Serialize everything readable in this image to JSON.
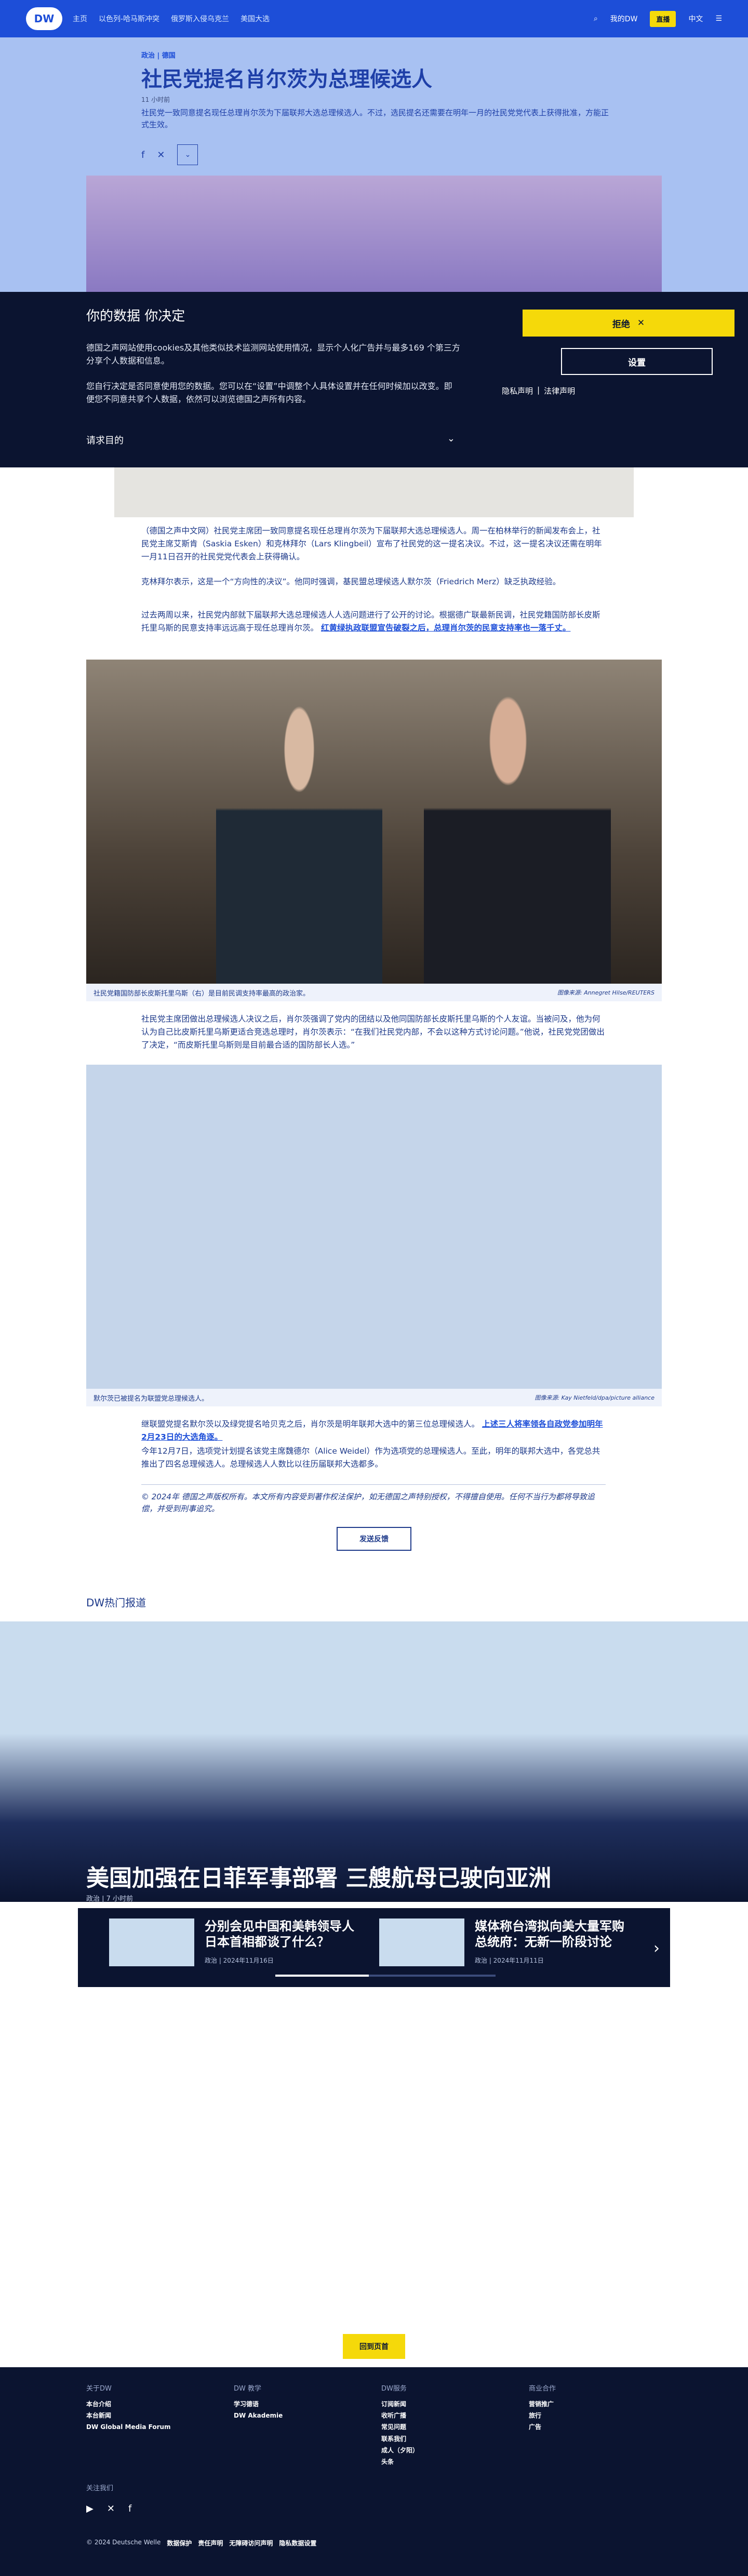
{
  "nav": {
    "logo": "DW",
    "links": [
      "主页",
      "以色列-哈马斯冲突",
      "俄罗斯入侵乌克兰",
      "美国大选"
    ],
    "account": "我的DW",
    "live": "直播",
    "lang": "中文"
  },
  "article": {
    "breadcrumb": "政治 | 德国",
    "title": "社民党提名肖尔茨为总理候选人",
    "date": "11 小时前",
    "lead": "社民党一致同意提名现任总理肖尔茨为下届联邦大选总理候选人。不过，选民提名还需要在明年一月的社民党党代表上获得批准，方能正式生效。",
    "p1": "（德国之声中文网）社民党主席团一致同意提名现任总理肖尔茨为下届联邦大选总理候选人。周一在柏林举行的新闻发布会上，社民党主席艾斯肯（Saskia Esken）和克林拜尔（Lars Klingbeil）宣布了社民党的这一提名决议。不过，这一提名决议还需在明年一月11日召开的社民党党代表会上获得确认。",
    "p2": "克林拜尔表示，这是一个“方向性的决议”。他同时强调，基民盟总理候选人默尔茨（Friedrich Merz）缺乏执政经验。",
    "p3": "过去两周以来，社民党内部就下届联邦大选总理候选人人选问题进行了公开的讨论。根据德广联最新民调，社民党籍国防部长皮斯托里乌斯的民意支持率远远高于现任总理肖尔茨。",
    "p3_link": "红黄绿执政联盟宣告破裂之后，总理肖尔茨的民意支持率也一落千丈。",
    "caption1": "社民党籍国防部长皮斯托里乌斯（右）是目前民调支持率最高的政治家。",
    "credit1": "图像来源: Annegret Hilse/REUTERS",
    "p4": "社民党主席团做出总理候选人决议之后，肖尔茨强调了党内的团结以及他同国防部长皮斯托里乌斯的个人友谊。当被问及，他为何认为自己比皮斯托里乌斯更适合竞选总理时，肖尔茨表示：“在我们社民党内部，不会以这种方式讨论问题。”他说，社民党党团做出了决定，“而皮斯托里乌斯则是目前最合适的国防部长人选。”",
    "caption2": "默尔茨已被提名为联盟党总理候选人。",
    "credit2": "图像来源: Kay Nietfeld/dpa/picture alliance",
    "p5": "继联盟党提名默尔茨以及绿党提名哈贝克之后，肖尔茨是明年联邦大选中的第三位总理候选人。",
    "p5_link": "上述三人将率领各自政党参加明年2月23日的大选角逐。",
    "p6": "今年12月7日，选项党计划提名该党主席魏德尔（Alice Weidel）作为选项党的总理候选人。至此，明年的联邦大选中，各党总共推出了四名总理候选人。总理候选人人数比以往历届联邦大选都多。",
    "notice": "© 2024年 德国之声版权所有。本文所有内容受到著作权法保护，如无德国之声特别授权，不得擅自使用。任何不当行为都将导致追偿，并受到刑事追究。",
    "feedback": "发送反馈"
  },
  "consent": {
    "title": "你的数据 你决定",
    "p1": "德国之声网站使用cookies及其他类似技术监测网站使用情况，显示个人化广告并与最多169 个第三方分享个人数据和信息。",
    "p2": "您自行决定是否同意使用您的数据。您可以在“设置”中调整个人具体设置并在任何时候加以改变。即便您不同意共享个人数据，依然可以浏览德国之声所有内容。",
    "purposes": "请求目的",
    "reject": "拒绝",
    "settings": "设置",
    "privacy": "隐私声明",
    "legal": "法律声明"
  },
  "trending": {
    "label": "DW热门报道",
    "hero_title": "美国加强在日菲军事部署 三艘航母已驶向亚洲",
    "hero_meta": "政治 | 7 小时前",
    "cards": [
      {
        "title": "分别会见中国和美韩领导人 日本首相都谈了什么？",
        "meta": "政治 | 2024年11月16日"
      },
      {
        "title": "媒体称台湾拟向美大量军购 总统府：无新一阶段讨论",
        "meta": "政治 | 2024年11月11日"
      }
    ]
  },
  "back_to_top": "回到页首",
  "footer": {
    "cols": [
      {
        "title": "关于DW",
        "items": [
          "本台介绍",
          "本台新闻",
          "DW Global Media Forum"
        ]
      },
      {
        "title": "DW 教学",
        "items": [
          "学习德语",
          "DW Akademie"
        ]
      },
      {
        "title": "DW服务",
        "items": [
          "订阅新闻",
          "收听广播",
          "常见问题",
          "联系我们",
          "成人（夕阳）",
          "头条"
        ]
      },
      {
        "title": "商业合作",
        "items": [
          "营销推广",
          "旅行",
          "广告"
        ]
      }
    ],
    "follow": "关注我们",
    "bottom": [
      "© 2024 Deutsche Welle",
      "数据保护",
      "责任声明",
      "无障碍访问声明",
      "隐私数据设置"
    ]
  },
  "colors": {
    "brand": "#1d4ed8",
    "accent": "#f5d90a",
    "dark": "#0b1430"
  }
}
